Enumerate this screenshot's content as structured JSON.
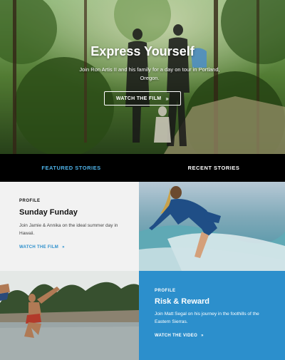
{
  "hero": {
    "title": "Express Yourself",
    "subtitle": "Join Ron Artis II and his family for a day on tour in Portland, Oregon.",
    "button_label": "WATCH THE FILM"
  },
  "tabs": [
    {
      "label": "FEATURED STORIES",
      "active": true
    },
    {
      "label": "RECENT STORIES",
      "active": false
    }
  ],
  "stories": [
    {
      "kicker": "PROFILE",
      "title": "Sunday Funday",
      "description": "Join Jamie & Annika on the ideal summer day in Hawaii.",
      "link_label": "WATCH THE FILM"
    },
    {
      "kicker": "PROFILE",
      "title": "Risk & Reward",
      "description": "Join Matt Segal on his journey in the foothills of the Eastern Sierras.",
      "link_label": "WATCH THE VIDEO"
    }
  ],
  "colors": {
    "accent": "#2c8fcc",
    "tab_active": "#4fb4ea",
    "tab_bar": "#000000",
    "card_light": "#f2f2f2"
  },
  "icons": {
    "link_arrow": "chevron-right-icon"
  }
}
